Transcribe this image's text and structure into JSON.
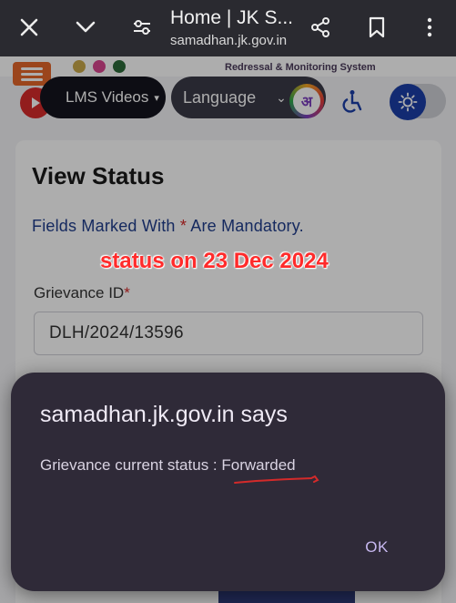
{
  "browser": {
    "title": "Home | JK S...",
    "url": "samadhan.jk.gov.in",
    "icons": [
      "close-icon",
      "chevron-down-icon",
      "site-settings-icon",
      "share-icon",
      "bookmark-icon",
      "more-vert-icon"
    ]
  },
  "site": {
    "system_title": "Redressal & Monitoring System",
    "nav": {
      "lms_label": "LMS Videos",
      "language_label": "Language",
      "language_badge": "अ"
    },
    "accent_color": "#1b3fa8"
  },
  "card": {
    "title": "View Status",
    "mandatory_pre": "Fields Marked With ",
    "mandatory_star": "*",
    "mandatory_post": " Are Mandatory.",
    "grievance_label": "Grievance ID",
    "grievance_star": "*",
    "grievance_value": "DLH/2024/13596"
  },
  "annotation": {
    "text": "status on 23 Dec 2024",
    "color": "#ff2b2b"
  },
  "dialog": {
    "title": "samadhan.jk.gov.in says",
    "message_prefix": "Grievance current status : ",
    "status": "Forwarded",
    "ok_label": "OK"
  }
}
